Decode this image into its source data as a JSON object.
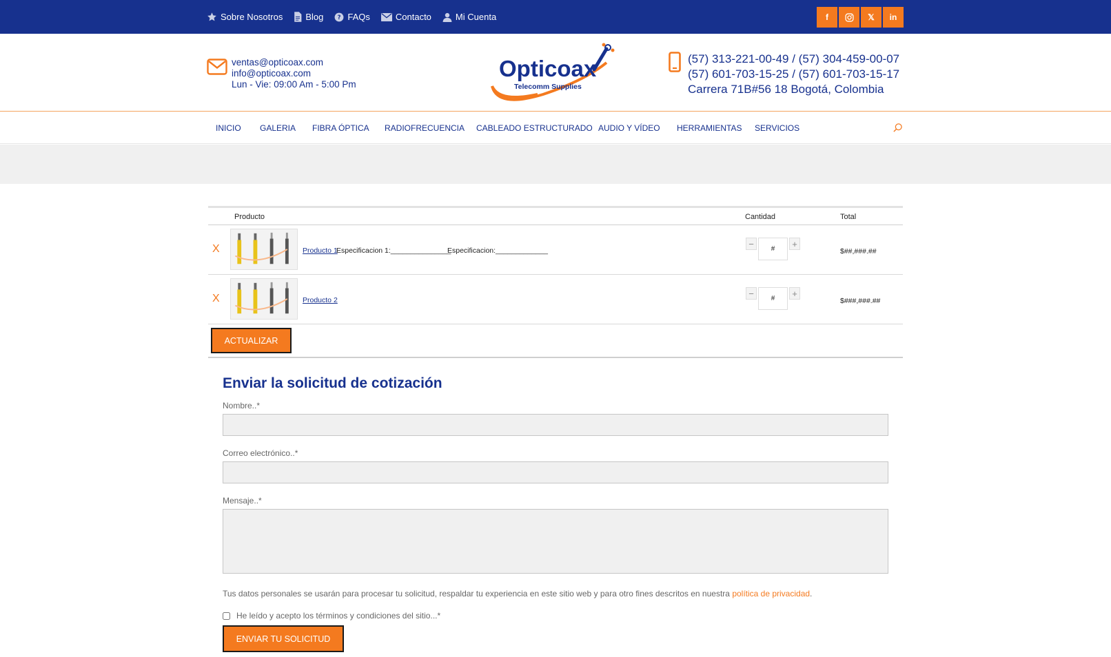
{
  "topbar": {
    "links": [
      {
        "label": "Sobre Nosotros",
        "icon": "star-icon"
      },
      {
        "label": "Blog",
        "icon": "document-icon"
      },
      {
        "label": "FAQs",
        "icon": "question-icon"
      },
      {
        "label": "Contacto",
        "icon": "envelope-icon"
      },
      {
        "label": "Mi Cuenta",
        "icon": "user-icon"
      }
    ],
    "social": [
      {
        "name": "facebook-icon",
        "glyph": "f"
      },
      {
        "name": "instagram-icon",
        "glyph": ""
      },
      {
        "name": "x-twitter-icon",
        "glyph": "𝕏"
      },
      {
        "name": "linkedin-icon",
        "glyph": "in"
      }
    ]
  },
  "header": {
    "email_lines": [
      "ventas@opticoax.com",
      "info@opticoax.com",
      "Lun - Vie: 09:00 Am - 5:00 Pm"
    ],
    "logo": {
      "text_main": "Opticoax",
      "text_sub": "Telecomm Supplies"
    },
    "phone_lines": [
      "(57) 313-221-00-49 / (57) 304-459-00-07",
      "(57) 601-703-15-25 / (57) 601-703-15-17",
      "Carrera 71B#56 18 Bogotá, Colombia"
    ]
  },
  "nav": {
    "items": [
      "INICIO",
      "GALERIA",
      "FIBRA ÓPTICA",
      "RADIOFRECUENCIA",
      "CABLEADO ESTRUCTURADO",
      "AUDIO Y VÍDEO",
      "HERRAMIENTAS",
      "SERVICIOS"
    ]
  },
  "cart": {
    "headers": {
      "product": "Producto",
      "quantity": "Cantidad",
      "total": "Total"
    },
    "remove_label": "X",
    "rows": [
      {
        "name": "Producto 1",
        "spec1": "Especificacion 1:_______________",
        "spec2": "Especificacion:_____________",
        "qty": "#",
        "total": "$##,###.##"
      },
      {
        "name": "Producto 2",
        "spec1": "",
        "spec2": "",
        "qty": "#",
        "total": "$###,###.##"
      }
    ],
    "update_label": "ACTUALIZAR"
  },
  "form": {
    "title": "Enviar la solicitud de cotización",
    "name_label": "Nombre..*",
    "email_label": "Correo electrónico..*",
    "message_label": "Mensaje..*",
    "privacy_text": "Tus datos personales se usarán para procesar tu solicitud, respaldar tu experiencia en este sitio web y para otro fines descritos en nuestra",
    "privacy_link": "política de privacidad",
    "privacy_end": ".",
    "terms_label": "He leído y acepto los términos y condiciones del sitio...*",
    "submit_label": "ENVIAR TU SOLICITUD"
  },
  "colors": {
    "brand_blue": "#17318e",
    "accent_orange": "#f47a1f"
  }
}
